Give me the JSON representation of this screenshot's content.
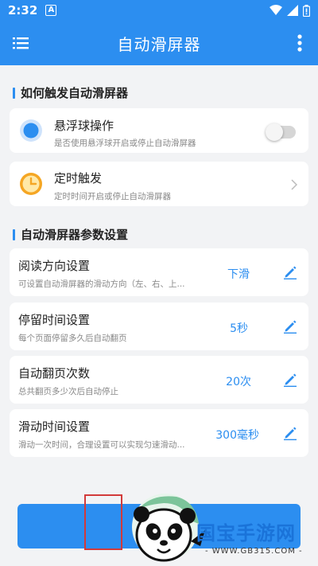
{
  "status_bar": {
    "time": "2:32",
    "badge": "A"
  },
  "app_bar": {
    "title": "自动滑屏器",
    "menu_icon": "hamburger-menu-icon",
    "more_icon": "more-vertical-icon"
  },
  "section_trigger": {
    "title": "如何触发自动滑屏器",
    "items": [
      {
        "label": "悬浮球操作",
        "description": "是否使用悬浮球开启或停止自动滑屏器",
        "icon": "floating-ball-icon",
        "toggle_on": false
      },
      {
        "label": "定时触发",
        "description": "定时时间开启或停止自动滑屏器",
        "icon": "clock-icon"
      }
    ]
  },
  "section_params": {
    "title": "自动滑屏器参数设置",
    "items": [
      {
        "label": "阅读方向设置",
        "description": "可设置自动滑屏器的滑动方向（左、右、上...",
        "value": "下滑"
      },
      {
        "label": "停留时间设置",
        "description": "每个页面停留多久后自动翻页",
        "value": "5秒"
      },
      {
        "label": "自动翻页次数",
        "description": "总共翻页多少次后自动停止",
        "value": "20次"
      },
      {
        "label": "滑动时间设置",
        "description": "滑动一次时间，合理设置可以实现匀速滑动...",
        "value": "300毫秒"
      }
    ]
  },
  "watermark": {
    "brand": "国宝手游网",
    "url": "- WWW.GB315.COM -"
  },
  "colors": {
    "primary": "#2c8ef0",
    "accent_orange": "#f5a623"
  }
}
